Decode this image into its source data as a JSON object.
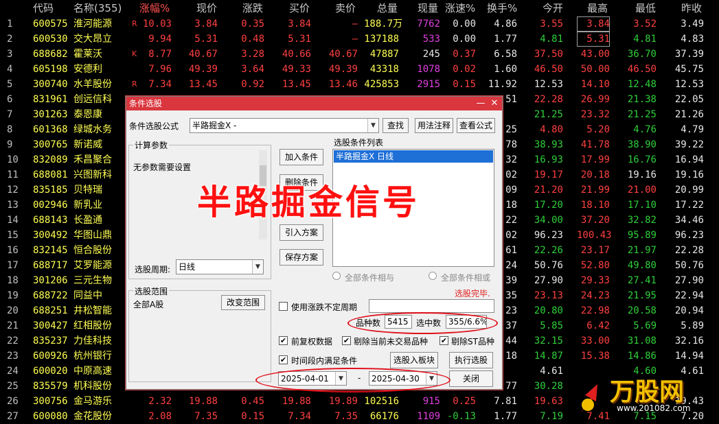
{
  "header": [
    "代码",
    "名称(355)",
    "涨幅%",
    "现价",
    "涨跌",
    "买价",
    "卖价",
    "总量",
    "现量",
    "涨速%",
    "换手%",
    "今开",
    "最高",
    "最低",
    "昨收"
  ],
  "rows": [
    {
      "no": "1",
      "code": "600575",
      "name": "淮河能源",
      "flag": "R",
      "pct": "10.03",
      "price": "3.84",
      "chg": "0.35",
      "bid": "3.84",
      "ask": "–",
      "vol": "188.7万",
      "cur": "7762",
      "spd": "0.00",
      "turn": "4.86",
      "open": "3.55",
      "high": "3.84",
      "low": "3.52",
      "prev": "3.49"
    },
    {
      "no": "2",
      "code": "600530",
      "name": "交大昂立",
      "flag": "",
      "pct": "9.94",
      "price": "5.31",
      "chg": "0.48",
      "bid": "5.31",
      "ask": "–",
      "vol": "137188",
      "cur": "533",
      "spd": "0.00",
      "turn": "1.77",
      "open": "4.81",
      "high": "5.31",
      "low": "4.81",
      "prev": "4.83"
    },
    {
      "no": "3",
      "code": "688682",
      "name": "霍莱沃",
      "flag": "K",
      "pct": "8.77",
      "price": "40.67",
      "chg": "3.28",
      "bid": "40.66",
      "ask": "40.67",
      "vol": "47887",
      "cur": "245",
      "spd": "0.37",
      "turn": "6.58",
      "open": "37.50",
      "high": "43.00",
      "low": "36.70",
      "prev": "37.39"
    },
    {
      "no": "4",
      "code": "605198",
      "name": "安德利",
      "flag": "",
      "pct": "7.96",
      "price": "49.39",
      "chg": "3.64",
      "bid": "49.33",
      "ask": "49.39",
      "vol": "43318",
      "cur": "1078",
      "spd": "0.02",
      "turn": "1.60",
      "open": "46.50",
      "high": "50.00",
      "low": "46.50",
      "prev": "45.75"
    },
    {
      "no": "5",
      "code": "300740",
      "name": "水羊股份",
      "flag": "R",
      "pct": "7.34",
      "price": "13.45",
      "chg": "0.92",
      "bid": "13.45",
      "ask": "13.46",
      "vol": "425853",
      "cur": "2915",
      "spd": "0.15",
      "turn": "11.92",
      "open": "12.53",
      "high": "14.10",
      "low": "12.48",
      "prev": "12.53"
    },
    {
      "no": "6",
      "code": "831961",
      "name": "创远信科",
      "pct": "",
      "price": "",
      "chg": "",
      "bid": "",
      "ask": "",
      "vol": "",
      "cur": "",
      "spd": "",
      "turn": "51",
      "open": "22.28",
      "high": "26.99",
      "low": "21.38",
      "prev": "22.05"
    },
    {
      "no": "7",
      "code": "301263",
      "name": "泰恩康",
      "turn": "",
      "open": "21.25",
      "high": "23.32",
      "low": "21.25",
      "prev": "21.26"
    },
    {
      "no": "8",
      "code": "601368",
      "name": "绿城水务",
      "turn": "25",
      "open": "4.80",
      "high": "5.20",
      "low": "4.76",
      "prev": "4.79"
    },
    {
      "no": "9",
      "code": "300765",
      "name": "新诺威",
      "turn": "78",
      "open": "38.93",
      "high": "41.78",
      "low": "38.90",
      "prev": "39.22"
    },
    {
      "no": "10",
      "code": "832089",
      "name": "禾昌聚合",
      "turn": "32",
      "open": "16.93",
      "high": "17.99",
      "low": "16.76",
      "prev": "16.94"
    },
    {
      "no": "11",
      "code": "688081",
      "name": "兴图新科",
      "turn": "02",
      "open": "19.17",
      "high": "20.18",
      "low": "19.16",
      "prev": "19.16"
    },
    {
      "no": "12",
      "code": "835185",
      "name": "贝特瑞",
      "turn": "09",
      "open": "21.20",
      "high": "21.99",
      "low": "21.00",
      "prev": "20.99"
    },
    {
      "no": "13",
      "code": "002946",
      "name": "新乳业",
      "turn": "18",
      "open": "17.20",
      "high": "18.10",
      "low": "17.10",
      "prev": "17.22"
    },
    {
      "no": "14",
      "code": "688143",
      "name": "长盈通",
      "turn": "22",
      "open": "34.00",
      "high": "37.20",
      "low": "32.82",
      "prev": "34.46"
    },
    {
      "no": "15",
      "code": "300492",
      "name": "华图山鼎",
      "turn": "02",
      "open": "96.23",
      "high": "100.43",
      "low": "95.89",
      "prev": "96.23"
    },
    {
      "no": "16",
      "code": "832145",
      "name": "恒合股份",
      "turn": "61",
      "open": "22.26",
      "high": "23.17",
      "low": "21.97",
      "prev": "22.28"
    },
    {
      "no": "17",
      "code": "688717",
      "name": "艾罗能源",
      "turn": "24",
      "open": "50.76",
      "high": "52.80",
      "low": "49.80",
      "prev": "50.76"
    },
    {
      "no": "18",
      "code": "301206",
      "name": "三元生物",
      "turn": "39",
      "open": "27.90",
      "high": "29.33",
      "low": "27.41",
      "prev": "27.90"
    },
    {
      "no": "19",
      "code": "688722",
      "name": "同益中",
      "turn": "35",
      "open": "23.13",
      "high": "24.23",
      "low": "21.95",
      "prev": "22.94"
    },
    {
      "no": "20",
      "code": "688251",
      "name": "井松智能",
      "turn": "23",
      "open": "20.80",
      "high": "22.98",
      "low": "20.58",
      "prev": "20.94"
    },
    {
      "no": "21",
      "code": "300427",
      "name": "红相股份",
      "turn": "37",
      "open": "5.85",
      "high": "6.42",
      "low": "5.69",
      "prev": "5.89"
    },
    {
      "no": "22",
      "code": "835237",
      "name": "力佳科技",
      "turn": "44",
      "open": "32.15",
      "high": "33.00",
      "low": "31.08",
      "prev": "32.16"
    },
    {
      "no": "23",
      "code": "600926",
      "name": "杭州银行",
      "turn": "18",
      "open": "14.87",
      "high": "15.38",
      "low": "14.86",
      "prev": "14.94"
    },
    {
      "no": "24",
      "code": "600020",
      "name": "中原高速",
      "turn": "",
      "open": "4.61",
      "high": "",
      "low": "4.60",
      "prev": "4.61"
    },
    {
      "no": "25",
      "code": "835579",
      "name": "机科股份",
      "turn": "77",
      "open": "30.28",
      "high": "",
      "low": "",
      "prev": ""
    },
    {
      "no": "26",
      "code": "300756",
      "name": "金马游乐",
      "flag": "",
      "pct": "2.32",
      "price": "19.88",
      "chg": "0.45",
      "bid": "19.88",
      "ask": "19.89",
      "vol": "102516",
      "cur": "915",
      "spd": "0.25",
      "turn": "7.81",
      "open": "19.63",
      "high": "",
      "low": "",
      "prev": "19.43"
    },
    {
      "no": "27",
      "code": "600080",
      "name": "金花股份",
      "flag": "",
      "pct": "2.08",
      "price": "7.35",
      "chg": "0.15",
      "bid": "7.34",
      "ask": "7.35",
      "vol": "66176",
      "cur": "1109",
      "spd": "-0.13",
      "turn": "1.77",
      "open": "7.19",
      "high": "7.41",
      "low": "7.15",
      "prev": "7.20"
    }
  ],
  "dialog": {
    "title": "条件选股",
    "formula_label": "条件选股公式",
    "formula_value": "半路掘金X  -",
    "btn_find": "查找",
    "btn_usage": "用法注释",
    "btn_view": "查看公式",
    "params_group": "计算参数",
    "params_text": "无参数需要设置",
    "btn_add": "加入条件",
    "btn_delete": "删除条件",
    "btn_import": "引入方案",
    "btn_save": "保存方案",
    "list_group": "选股条件列表",
    "list_item": "半路掘金X  日线",
    "period_label": "选股周期:",
    "period_value": "日线",
    "radio_and": "全部条件相与",
    "radio_or": "全部条件相或",
    "status": "选股完毕.",
    "range_group": "选股范围",
    "range_value": "全部A股",
    "btn_change_range": "改变范围",
    "use_period": "使用涨跌不定周期",
    "count_label": "品种数",
    "count_value": "5415",
    "selected_label": "选中数",
    "selected_value": "355/6.6%",
    "cb_adjust": "前复权数据",
    "cb_exclude_today": "剔除当前未交易品种",
    "cb_exclude_st": "剔除ST品种",
    "cb_in_period": "时间段内满足条件",
    "btn_to_block": "选股入板块",
    "btn_execute": "执行选股",
    "date_from": "2025-04-01",
    "date_to": "2025-04-30",
    "date_sep": "-",
    "btn_close": "关闭"
  },
  "overlay_text": "半路掘金信号",
  "logo_text": "万股网",
  "logo_url": "www.201082.com"
}
